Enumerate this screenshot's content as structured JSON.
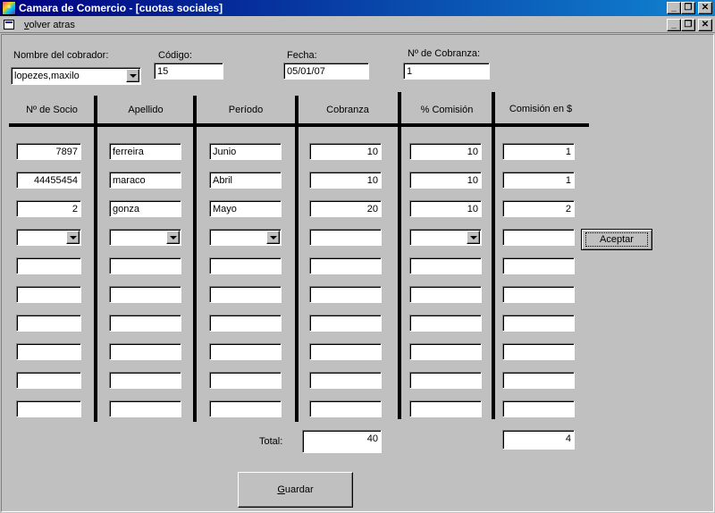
{
  "window": {
    "title": "Camara de Comercio - [cuotas sociales]"
  },
  "menu": {
    "volver_first": "v",
    "volver_rest": "olver atras"
  },
  "form": {
    "cobrador_label": "Nombre del cobrador:",
    "cobrador_value": "lopezes,maxilo",
    "codigo_label": "Código:",
    "codigo_value": "15",
    "fecha_label": "Fecha:",
    "fecha_value": "05/01/07",
    "cobranza_num_label": "Nº de Cobranza:",
    "cobranza_num_value": "1"
  },
  "table": {
    "headers": [
      "Nº de Socio",
      "Apellido",
      "Período",
      "Cobranza",
      "% Comisión",
      "Comisión en $"
    ],
    "rows": [
      [
        "7897",
        "ferreira",
        "Junio",
        "10",
        "10",
        "1"
      ],
      [
        "44455454",
        "maraco",
        "Abril",
        "10",
        "10",
        "1"
      ],
      [
        "2",
        "gonza",
        "Mayo",
        "20",
        "10",
        "2"
      ],
      [
        "",
        "",
        "",
        "",
        "",
        ""
      ],
      [
        "",
        "",
        "",
        "",
        "",
        ""
      ],
      [
        "",
        "",
        "",
        "",
        "",
        ""
      ],
      [
        "",
        "",
        "",
        "",
        "",
        ""
      ],
      [
        "",
        "",
        "",
        "",
        "",
        ""
      ],
      [
        "",
        "",
        "",
        "",
        "",
        ""
      ],
      [
        "",
        "",
        "",
        "",
        "",
        ""
      ]
    ]
  },
  "totals": {
    "label": "Total:",
    "cobranza": "40",
    "comision": "4"
  },
  "buttons": {
    "aceptar": "Aceptar",
    "guardar_first": "G",
    "guardar_rest": "uardar"
  }
}
